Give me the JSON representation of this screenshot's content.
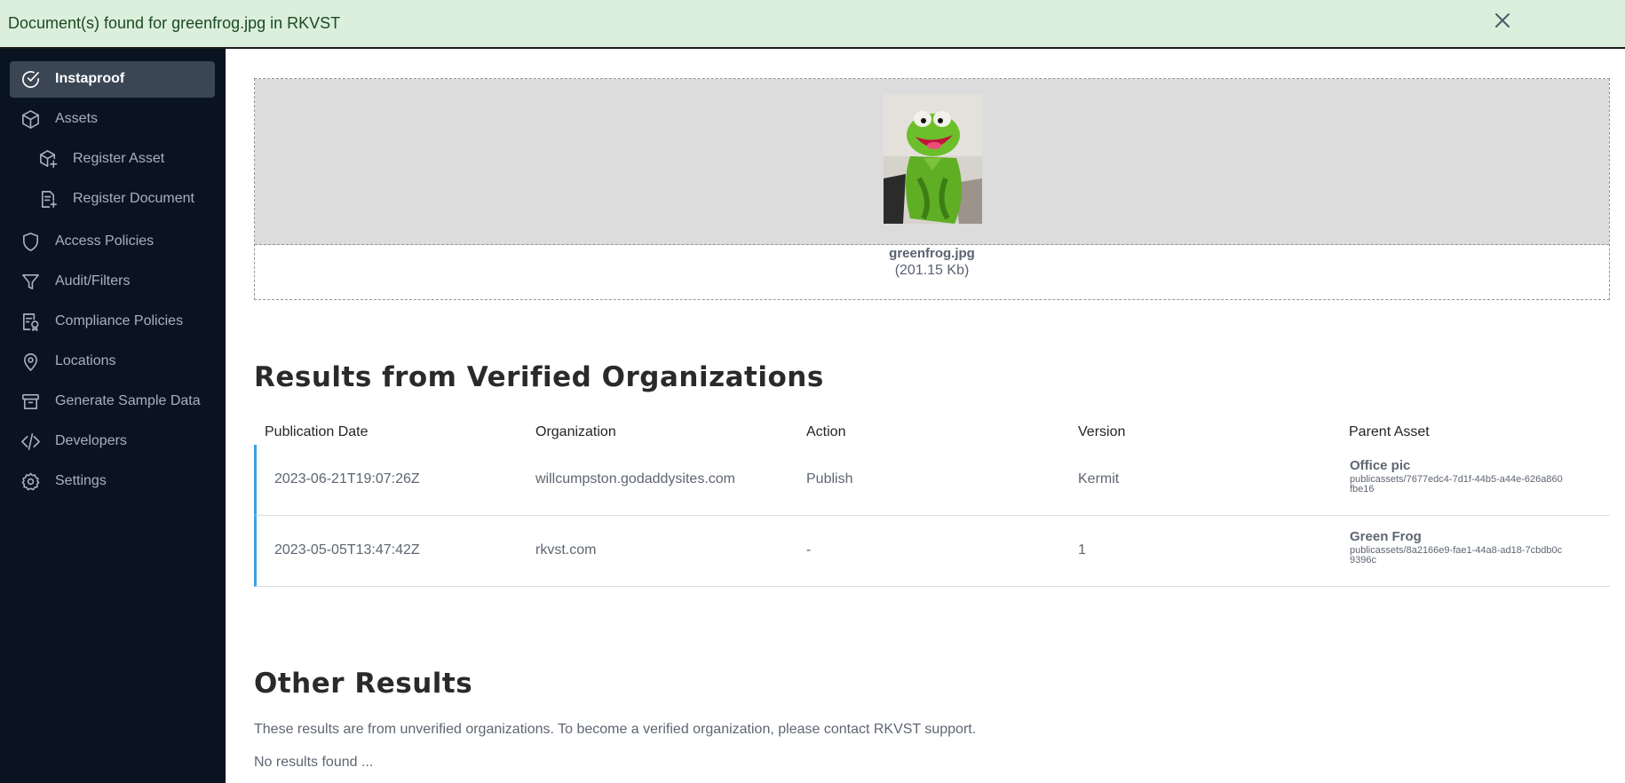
{
  "banner": {
    "message": "Document(s) found for greenfrog.jpg in RKVST",
    "close_icon": "close-icon"
  },
  "sidebar": {
    "items": [
      {
        "label": "Instaproof",
        "icon": "check-circle-icon",
        "active": true
      },
      {
        "label": "Assets",
        "icon": "box-icon"
      },
      {
        "label": "Register Asset",
        "icon": "box-plus-icon"
      },
      {
        "label": "Register Document",
        "icon": "document-plus-icon"
      },
      {
        "label": "Access Policies",
        "icon": "shield-icon"
      },
      {
        "label": "Audit/Filters",
        "icon": "filter-icon"
      },
      {
        "label": "Compliance Policies",
        "icon": "compliance-icon"
      },
      {
        "label": "Locations",
        "icon": "map-pin-icon"
      },
      {
        "label": "Generate Sample Data",
        "icon": "archive-icon"
      },
      {
        "label": "Developers",
        "icon": "code-icon"
      },
      {
        "label": "Settings",
        "icon": "gear-icon"
      }
    ]
  },
  "file": {
    "name": "greenfrog.jpg",
    "size": "(201.15 Kb)"
  },
  "verified": {
    "heading": "Results from Verified Organizations",
    "columns": [
      "Publication Date",
      "Organization",
      "Action",
      "Version",
      "Parent Asset"
    ],
    "rows": [
      {
        "date": "2023-06-21T19:07:26Z",
        "organization": "willcumpston.godaddysites.com",
        "action": "Publish",
        "version": "Kermit",
        "parent_name": "Office pic",
        "parent_id": "publicassets/7677edc4-7d1f-44b5-a44e-626a860fbe16"
      },
      {
        "date": "2023-05-05T13:47:42Z",
        "organization": "rkvst.com",
        "action": "-",
        "version": "1",
        "parent_name": "Green Frog",
        "parent_id": "publicassets/8a2166e9-fae1-44a8-ad18-7cbdb0c9396c"
      }
    ]
  },
  "other": {
    "heading": "Other Results",
    "note": "These results are from unverified organizations. To become a verified organization, please contact RKVST support.",
    "empty": "No results found ..."
  },
  "colors": {
    "banner_bg": "#dcefdc",
    "sidebar_bg": "#0a1421",
    "active_item_bg": "#3b4655",
    "row_accent": "#3aa1e6"
  }
}
